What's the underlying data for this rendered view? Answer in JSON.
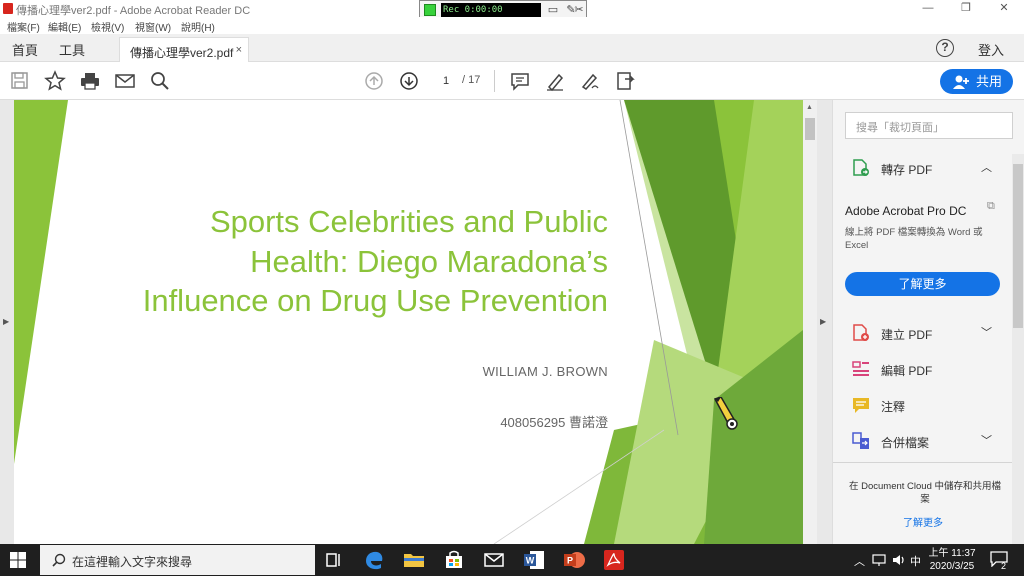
{
  "window": {
    "title": "傳播心理學ver2.pdf - Adobe Acrobat Reader DC",
    "controls": {
      "minimize": "—",
      "maximize": "❐",
      "close": "✕"
    }
  },
  "recorder": {
    "display": "Rec 0:00:00"
  },
  "menu": [
    "檔案(F)",
    "編輯(E)",
    "檢視(V)",
    "視窗(W)",
    "說明(H)"
  ],
  "tabs": {
    "home": "首頁",
    "tools": "工具",
    "document": "傳播心理學ver2.pdf",
    "close": "×",
    "login": "登入",
    "help": "?"
  },
  "toolbar": {
    "page_current": "1",
    "page_total": "/ 17",
    "share_label": "共用"
  },
  "slide": {
    "title_lines": [
      "Sports Celebrities and Public",
      "Health: Diego Maradona’s",
      "Influence on Drug Use Prevention"
    ],
    "author": "WILLIAM J. BROWN",
    "student": "408056295 曹諾澄",
    "colors": {
      "accent": "#8bc33a",
      "dark_green": "#5f9a2c",
      "light_green": "#c7e39a"
    }
  },
  "panel": {
    "search_placeholder": "搜尋「裁切頁面」",
    "export_pdf": "轉存 PDF",
    "promo_title": "Adobe Acrobat Pro DC",
    "promo_desc": "線上將 PDF 檔案轉換為 Word 或 Excel",
    "learn_more": "了解更多",
    "create_pdf": "建立 PDF",
    "edit_pdf": "編輯 PDF",
    "comment": "注釋",
    "combine": "合併檔案",
    "cloud_text": "在 Document Cloud 中儲存和共用檔案",
    "cloud_link": "了解更多"
  },
  "taskbar": {
    "search_placeholder": "在這裡輸入文字來搜尋",
    "ime": "中",
    "time": "上午 11:37",
    "date": "2020/3/25",
    "notif_count": "2"
  }
}
